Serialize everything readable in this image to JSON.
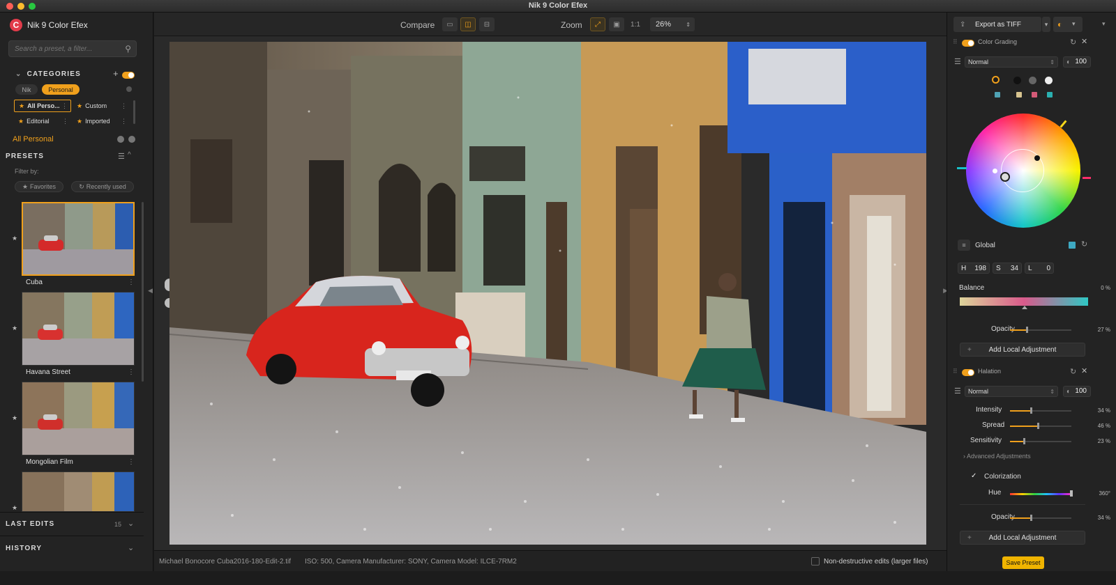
{
  "window": {
    "title": "Nik 9 Color Efex"
  },
  "left": {
    "brand": "Nik 9 Color Efex",
    "logo_letter": "C",
    "search_placeholder": "Search a preset, a filter...",
    "categories_title": "CATEGORIES",
    "tabs": [
      "Nik",
      "Personal"
    ],
    "category_items": [
      "All Perso...",
      "Custom",
      "Editorial",
      "Imported"
    ],
    "current_category": "All Personal",
    "presets_title": "PRESETS",
    "filter_by": "Filter by:",
    "filters": [
      "Favorites",
      "Recently used"
    ],
    "presets": [
      "Cuba",
      "Havana Street",
      "Mongolian Film"
    ],
    "last_edits_title": "LAST EDITS",
    "last_edits_count": "15",
    "history_title": "HISTORY"
  },
  "toolbar": {
    "compare_label": "Compare",
    "zoom_label": "Zoom",
    "zoom_one_to_one": "1:1",
    "zoom_value": "26%"
  },
  "status": {
    "filename": "Michael Bonocore Cuba2016-180-Edit-2.tif",
    "meta": "ISO: 500, Camera Manufacturer: SONY, Camera Model: ILCE-7RM2",
    "nondestructive": "Non-destructive edits (larger files)"
  },
  "right": {
    "export_label": "Export as TIFF",
    "color_grading": {
      "name": "Color Grading",
      "blend_mode": "Normal",
      "opacity_num": "100",
      "global_label": "Global",
      "h_label": "H",
      "h_value": "198",
      "s_label": "S",
      "s_value": "34",
      "l_label": "L",
      "l_value": "0",
      "balance_label": "Balance",
      "balance_value": "0 %",
      "opacity_label": "Opacity",
      "opacity_value": "27 %",
      "opacity_level": 0.27
    },
    "add_local_label": "Add Local Adjustment",
    "halation": {
      "name": "Halation",
      "blend_mode": "Normal",
      "opacity_num": "100",
      "intensity_label": "Intensity",
      "intensity_value": "34 %",
      "intensity_level": 0.34,
      "spread_label": "Spread",
      "spread_value": "46 %",
      "spread_level": 0.46,
      "sensitivity_label": "Sensitivity",
      "sensitivity_value": "23 %",
      "sensitivity_level": 0.23,
      "advanced_label": "Advanced Adjustments",
      "colorization_label": "Colorization",
      "hue_label": "Hue",
      "hue_value": "360°",
      "opacity_label": "Opacity",
      "opacity_value": "34 %",
      "opacity_level": 0.34
    },
    "save_preset_label": "Save Preset"
  },
  "colors": {
    "accent": "#f0a01c",
    "save_button": "#f0b400"
  }
}
